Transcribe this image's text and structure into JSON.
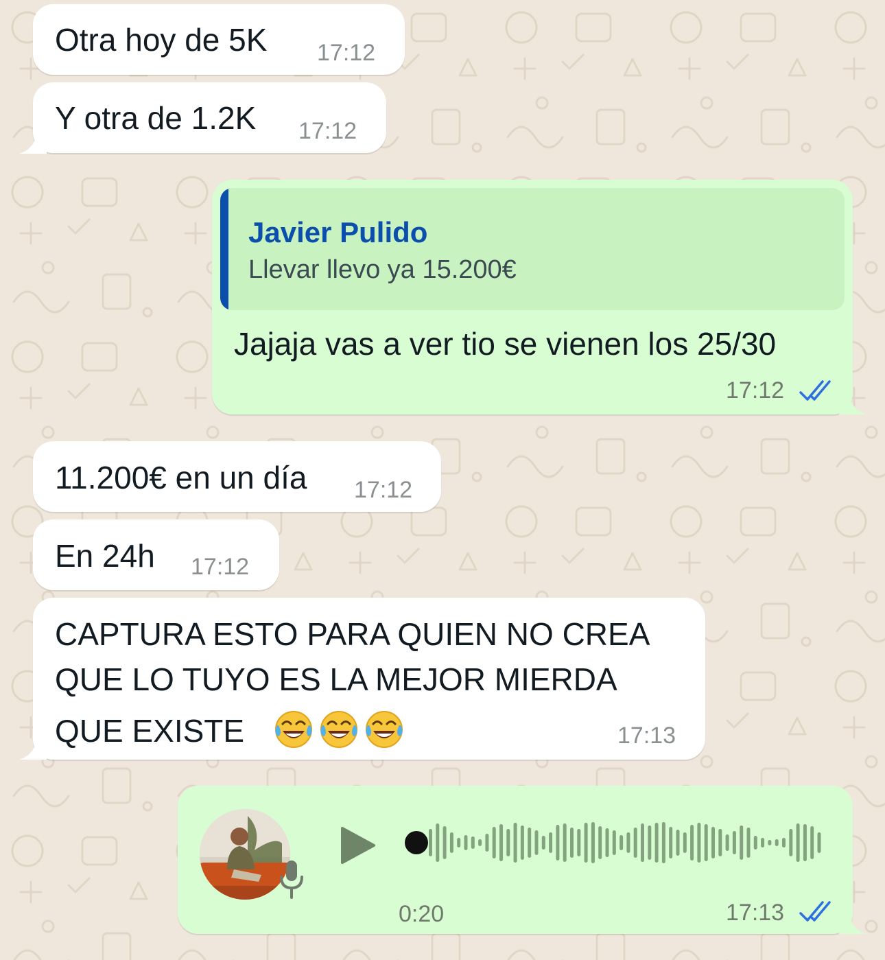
{
  "messages": [
    {
      "text": "Otra hoy de 5K",
      "time": "17:12"
    },
    {
      "text": "Y otra de 1.2K",
      "time": "17:12"
    },
    {
      "quote": {
        "author": "Javier Pulido",
        "text": "Llevar llevo ya 15.200€"
      },
      "text": "Jajaja vas a ver tio se vienen los 25/30",
      "time": "17:12",
      "status": "read"
    },
    {
      "text": "11.200€ en un día",
      "time": "17:12"
    },
    {
      "text": "En 24h",
      "time": "17:12"
    },
    {
      "lines": [
        "CAPTURA ESTO PARA QUIEN NO CREA",
        "QUE LO TUYO ES LA MEJOR MIERDA",
        "QUE EXISTE"
      ],
      "emoji": [
        "face-with-tears-of-joy",
        "face-with-tears-of-joy",
        "face-with-tears-of-joy"
      ],
      "time": "17:13"
    },
    {
      "type": "voice",
      "duration": "0:20",
      "time": "17:13",
      "status": "read"
    }
  ],
  "colors": {
    "wallpaper": "#efe7dc",
    "incoming_bubble": "#ffffff",
    "outgoing_bubble": "#d9fdd3",
    "quote_accent": "#0b4eab",
    "read_ticks": "#2f6fe0",
    "waveform": "#83a27e"
  },
  "icons": [
    "double-check-icon",
    "play-icon",
    "mic-icon",
    "avatar"
  ]
}
